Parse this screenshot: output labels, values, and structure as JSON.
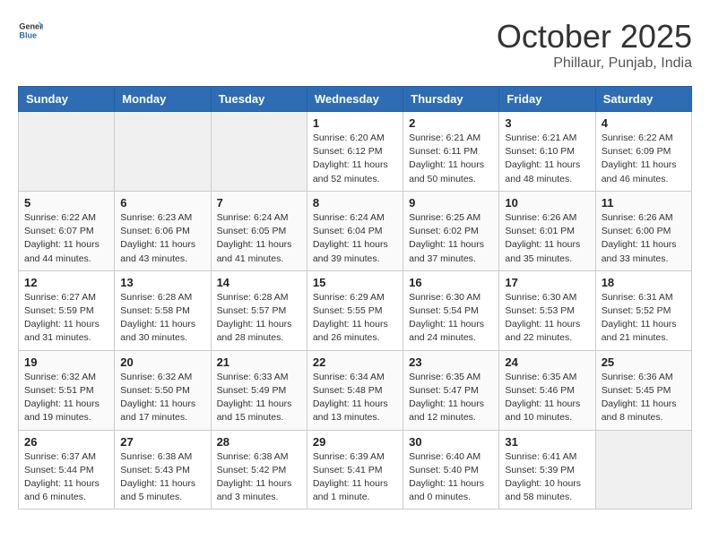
{
  "header": {
    "logo_general": "General",
    "logo_blue": "Blue",
    "month": "October 2025",
    "location": "Phillaur, Punjab, India"
  },
  "weekdays": [
    "Sunday",
    "Monday",
    "Tuesday",
    "Wednesday",
    "Thursday",
    "Friday",
    "Saturday"
  ],
  "weeks": [
    [
      {
        "day": "",
        "info": ""
      },
      {
        "day": "",
        "info": ""
      },
      {
        "day": "",
        "info": ""
      },
      {
        "day": "1",
        "info": "Sunrise: 6:20 AM\nSunset: 6:12 PM\nDaylight: 11 hours and 52 minutes."
      },
      {
        "day": "2",
        "info": "Sunrise: 6:21 AM\nSunset: 6:11 PM\nDaylight: 11 hours and 50 minutes."
      },
      {
        "day": "3",
        "info": "Sunrise: 6:21 AM\nSunset: 6:10 PM\nDaylight: 11 hours and 48 minutes."
      },
      {
        "day": "4",
        "info": "Sunrise: 6:22 AM\nSunset: 6:09 PM\nDaylight: 11 hours and 46 minutes."
      }
    ],
    [
      {
        "day": "5",
        "info": "Sunrise: 6:22 AM\nSunset: 6:07 PM\nDaylight: 11 hours and 44 minutes."
      },
      {
        "day": "6",
        "info": "Sunrise: 6:23 AM\nSunset: 6:06 PM\nDaylight: 11 hours and 43 minutes."
      },
      {
        "day": "7",
        "info": "Sunrise: 6:24 AM\nSunset: 6:05 PM\nDaylight: 11 hours and 41 minutes."
      },
      {
        "day": "8",
        "info": "Sunrise: 6:24 AM\nSunset: 6:04 PM\nDaylight: 11 hours and 39 minutes."
      },
      {
        "day": "9",
        "info": "Sunrise: 6:25 AM\nSunset: 6:02 PM\nDaylight: 11 hours and 37 minutes."
      },
      {
        "day": "10",
        "info": "Sunrise: 6:26 AM\nSunset: 6:01 PM\nDaylight: 11 hours and 35 minutes."
      },
      {
        "day": "11",
        "info": "Sunrise: 6:26 AM\nSunset: 6:00 PM\nDaylight: 11 hours and 33 minutes."
      }
    ],
    [
      {
        "day": "12",
        "info": "Sunrise: 6:27 AM\nSunset: 5:59 PM\nDaylight: 11 hours and 31 minutes."
      },
      {
        "day": "13",
        "info": "Sunrise: 6:28 AM\nSunset: 5:58 PM\nDaylight: 11 hours and 30 minutes."
      },
      {
        "day": "14",
        "info": "Sunrise: 6:28 AM\nSunset: 5:57 PM\nDaylight: 11 hours and 28 minutes."
      },
      {
        "day": "15",
        "info": "Sunrise: 6:29 AM\nSunset: 5:55 PM\nDaylight: 11 hours and 26 minutes."
      },
      {
        "day": "16",
        "info": "Sunrise: 6:30 AM\nSunset: 5:54 PM\nDaylight: 11 hours and 24 minutes."
      },
      {
        "day": "17",
        "info": "Sunrise: 6:30 AM\nSunset: 5:53 PM\nDaylight: 11 hours and 22 minutes."
      },
      {
        "day": "18",
        "info": "Sunrise: 6:31 AM\nSunset: 5:52 PM\nDaylight: 11 hours and 21 minutes."
      }
    ],
    [
      {
        "day": "19",
        "info": "Sunrise: 6:32 AM\nSunset: 5:51 PM\nDaylight: 11 hours and 19 minutes."
      },
      {
        "day": "20",
        "info": "Sunrise: 6:32 AM\nSunset: 5:50 PM\nDaylight: 11 hours and 17 minutes."
      },
      {
        "day": "21",
        "info": "Sunrise: 6:33 AM\nSunset: 5:49 PM\nDaylight: 11 hours and 15 minutes."
      },
      {
        "day": "22",
        "info": "Sunrise: 6:34 AM\nSunset: 5:48 PM\nDaylight: 11 hours and 13 minutes."
      },
      {
        "day": "23",
        "info": "Sunrise: 6:35 AM\nSunset: 5:47 PM\nDaylight: 11 hours and 12 minutes."
      },
      {
        "day": "24",
        "info": "Sunrise: 6:35 AM\nSunset: 5:46 PM\nDaylight: 11 hours and 10 minutes."
      },
      {
        "day": "25",
        "info": "Sunrise: 6:36 AM\nSunset: 5:45 PM\nDaylight: 11 hours and 8 minutes."
      }
    ],
    [
      {
        "day": "26",
        "info": "Sunrise: 6:37 AM\nSunset: 5:44 PM\nDaylight: 11 hours and 6 minutes."
      },
      {
        "day": "27",
        "info": "Sunrise: 6:38 AM\nSunset: 5:43 PM\nDaylight: 11 hours and 5 minutes."
      },
      {
        "day": "28",
        "info": "Sunrise: 6:38 AM\nSunset: 5:42 PM\nDaylight: 11 hours and 3 minutes."
      },
      {
        "day": "29",
        "info": "Sunrise: 6:39 AM\nSunset: 5:41 PM\nDaylight: 11 hours and 1 minute."
      },
      {
        "day": "30",
        "info": "Sunrise: 6:40 AM\nSunset: 5:40 PM\nDaylight: 11 hours and 0 minutes."
      },
      {
        "day": "31",
        "info": "Sunrise: 6:41 AM\nSunset: 5:39 PM\nDaylight: 10 hours and 58 minutes."
      },
      {
        "day": "",
        "info": ""
      }
    ]
  ]
}
